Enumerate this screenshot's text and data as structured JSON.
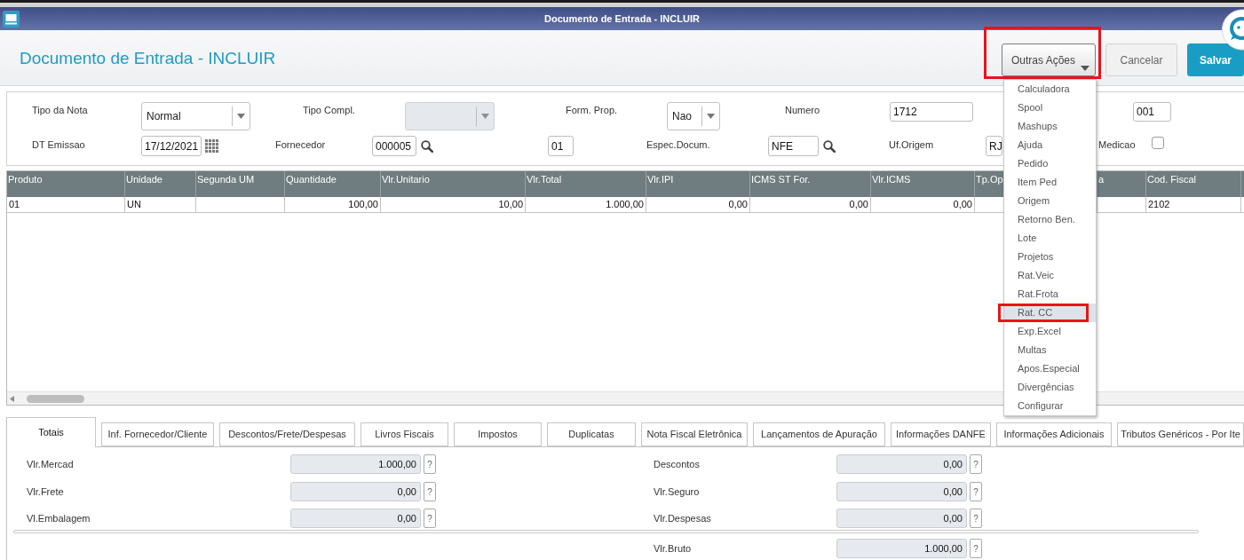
{
  "window": {
    "title": "Documento de Entrada - INCLUIR"
  },
  "header": {
    "title": "Documento de Entrada - INCLUIR",
    "buttons": [
      {
        "label": "Outras Ações",
        "kind": "menu",
        "annotated": true
      },
      {
        "label": "Cancelar",
        "kind": "secondary",
        "annotated": false
      },
      {
        "label": "Salvar",
        "kind": "primary",
        "annotated": false
      }
    ]
  },
  "actions_menu": {
    "items": [
      {
        "label": "Calculadora",
        "selected": false,
        "annotated": false
      },
      {
        "label": "Spool",
        "selected": false,
        "annotated": false
      },
      {
        "label": "Mashups",
        "selected": false,
        "annotated": false
      },
      {
        "label": "Ajuda",
        "selected": false,
        "annotated": false
      },
      {
        "label": "Pedido",
        "selected": false,
        "annotated": false
      },
      {
        "label": "Item Ped",
        "selected": false,
        "annotated": false
      },
      {
        "label": "Origem",
        "selected": false,
        "annotated": false
      },
      {
        "label": "Retorno Ben.",
        "selected": false,
        "annotated": false
      },
      {
        "label": "Lote",
        "selected": false,
        "annotated": false
      },
      {
        "label": "Projetos",
        "selected": false,
        "annotated": false
      },
      {
        "label": "Rat.Veic",
        "selected": false,
        "annotated": false
      },
      {
        "label": "Rat.Frota",
        "selected": false,
        "annotated": false
      },
      {
        "label": "Rat. CC",
        "selected": true,
        "annotated": true
      },
      {
        "label": "Exp.Excel",
        "selected": false,
        "annotated": false
      },
      {
        "label": "Multas",
        "selected": false,
        "annotated": false
      },
      {
        "label": "Apos.Especial",
        "selected": false,
        "annotated": false
      },
      {
        "label": "Divergências",
        "selected": false,
        "annotated": false
      },
      {
        "label": "Configurar",
        "selected": false,
        "annotated": false
      }
    ]
  },
  "form": {
    "rows": [
      [
        {
          "kind": "label",
          "text": "Tipo da Nota"
        },
        {
          "kind": "select",
          "value": "Normal",
          "disabled": false
        },
        {
          "kind": "label",
          "text": "Tipo Compl."
        },
        {
          "kind": "select",
          "disabled": true
        },
        {
          "kind": "label",
          "text": "Form. Prop."
        },
        {
          "kind": "select",
          "value": "Nao",
          "disabled": false
        },
        {
          "kind": "label",
          "text": "Numero"
        },
        {
          "kind": "input",
          "value": "1712"
        },
        {
          "kind": "input",
          "value": "001"
        }
      ],
      [
        {
          "kind": "label",
          "text": "DT Emissao"
        },
        {
          "kind": "date",
          "value": "17/12/2021"
        },
        {
          "kind": "label",
          "text": "Fornecedor"
        },
        {
          "kind": "lookup",
          "value": "000005"
        },
        {
          "kind": "input",
          "value": "01"
        },
        {
          "kind": "label",
          "text": "Espec.Docum."
        },
        {
          "kind": "lookup",
          "value": "NFE"
        },
        {
          "kind": "label",
          "text": "Uf.Origem"
        },
        {
          "kind": "input",
          "value": "RJ"
        },
        {
          "kind": "label",
          "text": "Medicao"
        },
        {
          "kind": "checkbox",
          "checked": false
        }
      ]
    ]
  },
  "table": {
    "columns": [
      "Produto",
      "Unidade",
      "Segunda UM",
      "Quantidade",
      "Vlr.Unitario",
      "Vlr.Total",
      "Vlr.IPI",
      "ICMS ST For.",
      "Vlr.ICMS",
      "Tp.Op",
      "a",
      "Cod. Fiscal"
    ],
    "rows": [
      [
        "01",
        "UN",
        null,
        "100,00",
        "10,00",
        "1.000,00",
        "0,00",
        "0,00",
        "0,00",
        null,
        null,
        "2102"
      ]
    ]
  },
  "tabs": [
    {
      "label": "Totais",
      "selected": true
    },
    {
      "label": "Inf. Fornecedor/Cliente",
      "selected": false
    },
    {
      "label": "Descontos/Frete/Despesas",
      "selected": false
    },
    {
      "label": "Livros Fiscais",
      "selected": false
    },
    {
      "label": "Impostos",
      "selected": false
    },
    {
      "label": "Duplicatas",
      "selected": false
    },
    {
      "label": "Nota Fiscal Eletrônica",
      "selected": false
    },
    {
      "label": "Lançamentos de Apuração",
      "selected": false
    },
    {
      "label": "Informações DANFE",
      "selected": false
    },
    {
      "label": "Informações Adicionais",
      "selected": false
    },
    {
      "label": "Tributos Genéricos - Por Ite",
      "selected": false
    }
  ],
  "totals": {
    "left": [
      {
        "label": "Vlr.Mercad",
        "value": "1.000,00",
        "help": "?"
      },
      {
        "label": "Vlr.Frete",
        "value": "0,00",
        "help": "?"
      },
      {
        "label": "Vl.Embalagem",
        "value": "0,00",
        "help": "?"
      }
    ],
    "right": [
      {
        "label": "Descontos",
        "value": "0,00",
        "help": "?"
      },
      {
        "label": "Vlr.Seguro",
        "value": "0,00",
        "help": "?"
      },
      {
        "label": "Vlr.Despesas",
        "value": "0,00",
        "help": "?"
      },
      {
        "label": "Vlr.Bruto",
        "value": "1.000,00",
        "help": "?"
      }
    ]
  }
}
